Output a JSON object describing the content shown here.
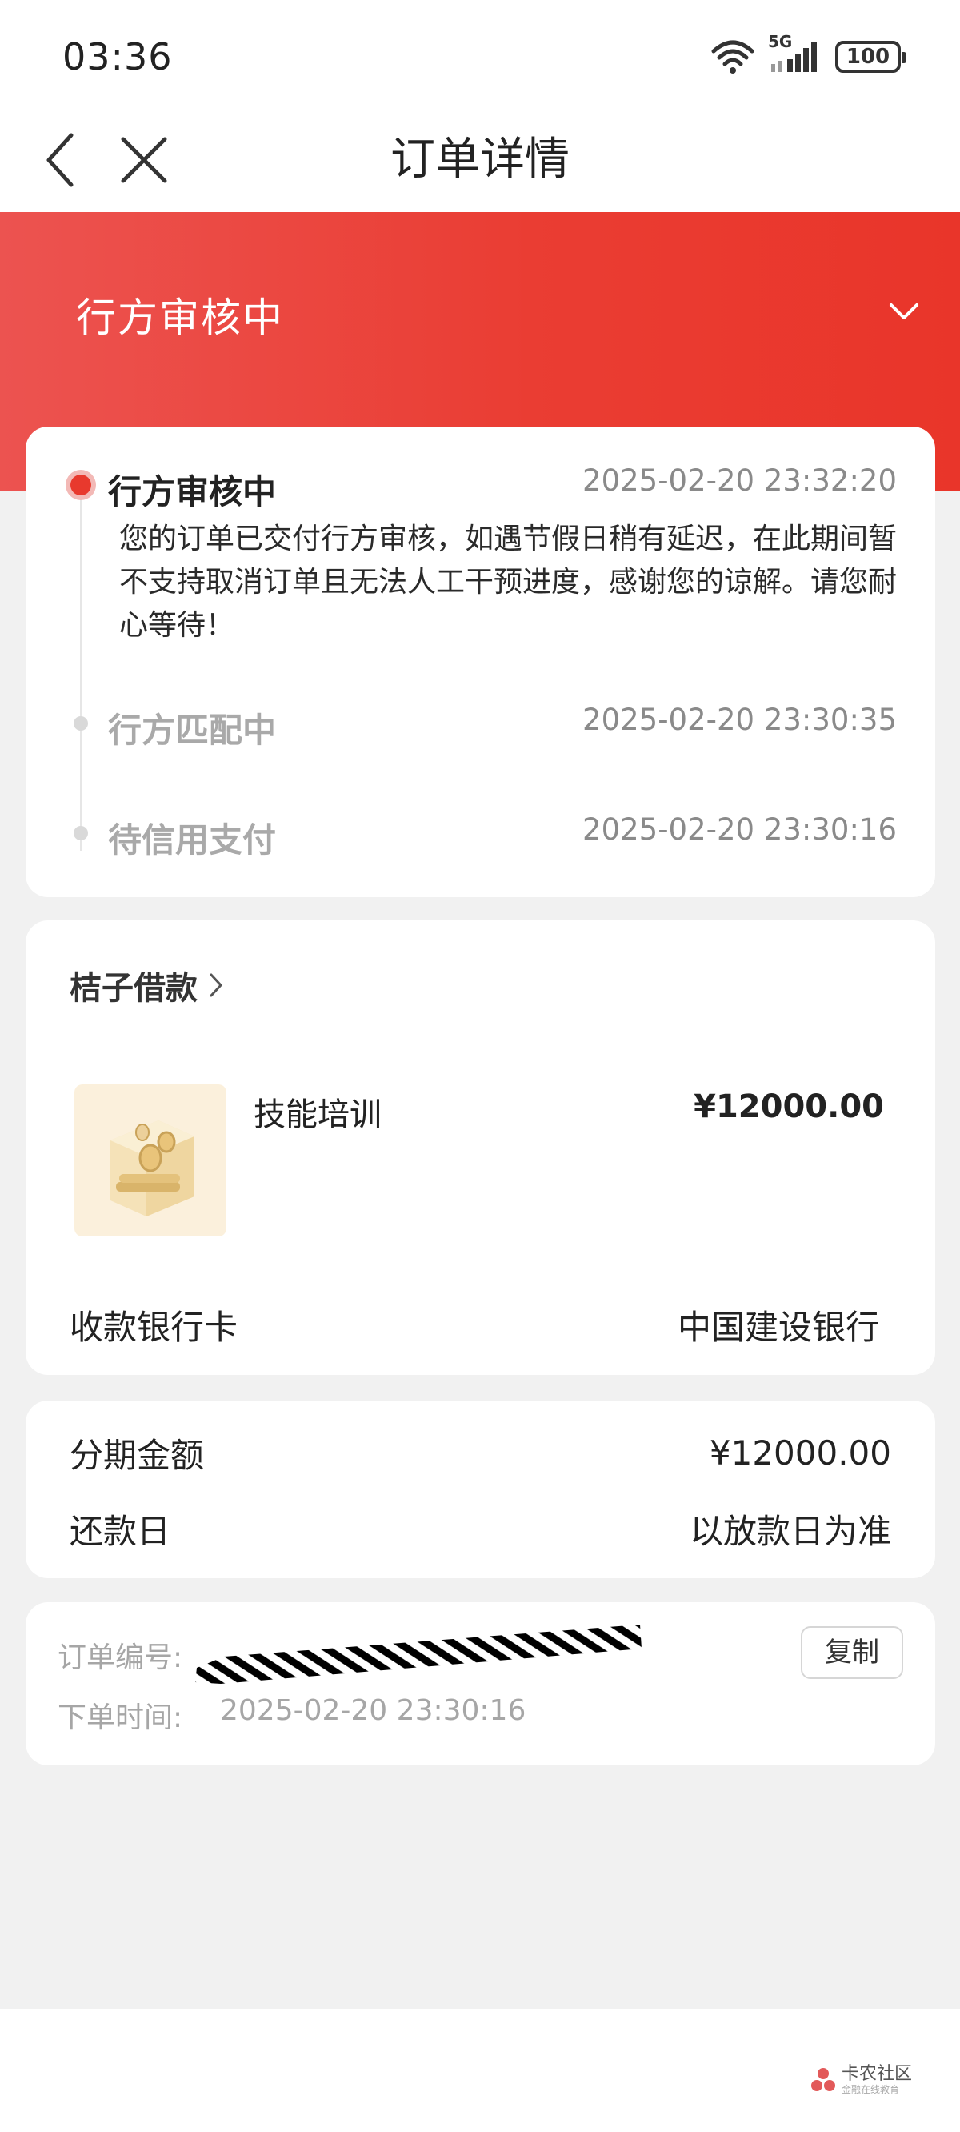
{
  "status_bar": {
    "time": "03:36",
    "network": "5G",
    "battery": "100"
  },
  "nav": {
    "title": "订单详情"
  },
  "banner": {
    "status": "行方审核中"
  },
  "timeline": {
    "steps": [
      {
        "title": "行方审核中",
        "time": "2025-02-20 23:32:20",
        "description": "您的订单已交付行方审核，如遇节假日稍有延迟，在此期间暂不支持取消订单且无法人工干预进度，感谢您的谅解。请您耐心等待！"
      },
      {
        "title": "行方匹配中",
        "time": "2025-02-20 23:30:35"
      },
      {
        "title": "待信用支付",
        "time": "2025-02-20 23:30:16"
      }
    ]
  },
  "merchant": {
    "name": "桔子借款",
    "product_name": "技能培训",
    "price": "¥12000.00",
    "bank_label": "收款银行卡",
    "bank_value": "中国建设银行"
  },
  "installment": {
    "amount_label": "分期金额",
    "amount_value": "¥12000.00",
    "repay_label": "还款日",
    "repay_value": "以放款日为准"
  },
  "order": {
    "number_label": "订单编号:",
    "time_label": "下单时间:",
    "time_value": "2025-02-20 23:30:16",
    "copy_label": "复制"
  },
  "watermark": {
    "text": "卡农社区",
    "sub": "金融在线教育"
  },
  "colors": {
    "accent": "#e8392d",
    "page_bg": "#f1f1f1"
  }
}
